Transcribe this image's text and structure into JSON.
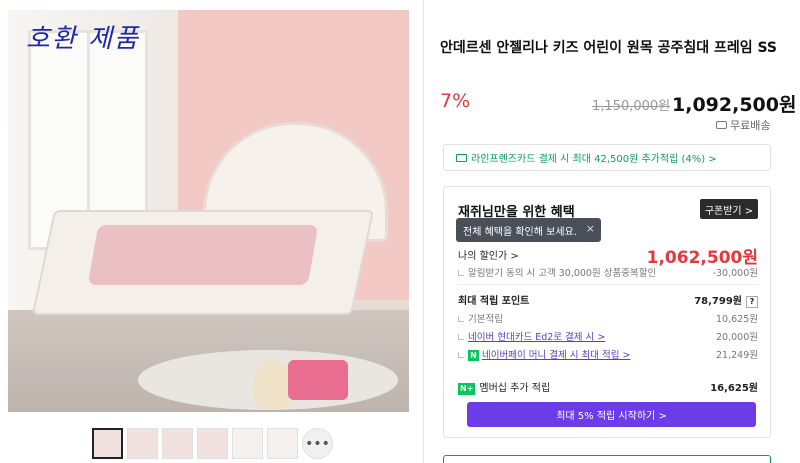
{
  "image": {
    "handwriting": "호환 제품"
  },
  "thumbnails": {
    "count": 7,
    "selected_index": 0,
    "more_label": "•••"
  },
  "product": {
    "title": "안데르센 안젤리나 키즈 어린이 원목 공주침대 프레임 SS",
    "discount": "7%",
    "original_price": "1,150,000원",
    "price": "1,092,500원",
    "shipping": "무료배송"
  },
  "card_banner": {
    "text": "라인프렌즈카드 결제 시 최대 42,500원 추가적립 (4%) >"
  },
  "benefits": {
    "heading": "재쥐님만을 위한 혜택",
    "coupon_button": "구폰받기 >",
    "tooltip": "전체 혜택을 확인해 보세요.",
    "tooltip_close": "×",
    "my_price_label": "나의 할인가 >",
    "my_price_value": "1,062,500원",
    "notify_label": "알림받기 동의 시 고객 30,000원 상품중복할인",
    "notify_value": "-30,000원",
    "points_label": "최대 적립 포인트",
    "points_value": "78,799원",
    "points_help": "?",
    "basic_label": "기본적립",
    "basic_value": "10,625원",
    "hyundai_label": "네이버 현대카드 Ed2로 결제 시 >",
    "hyundai_value": "20,000원",
    "npay_badge": "N",
    "npay_label": "네이버페이 머니 결제 시 최대 적립 >",
    "npay_value": "21,249원",
    "membership_badge": "N+",
    "membership_label": "멤버십 추가 적립",
    "membership_value": "16,625원",
    "cta_label": "최대 5% 적립 시작하기 >"
  }
}
